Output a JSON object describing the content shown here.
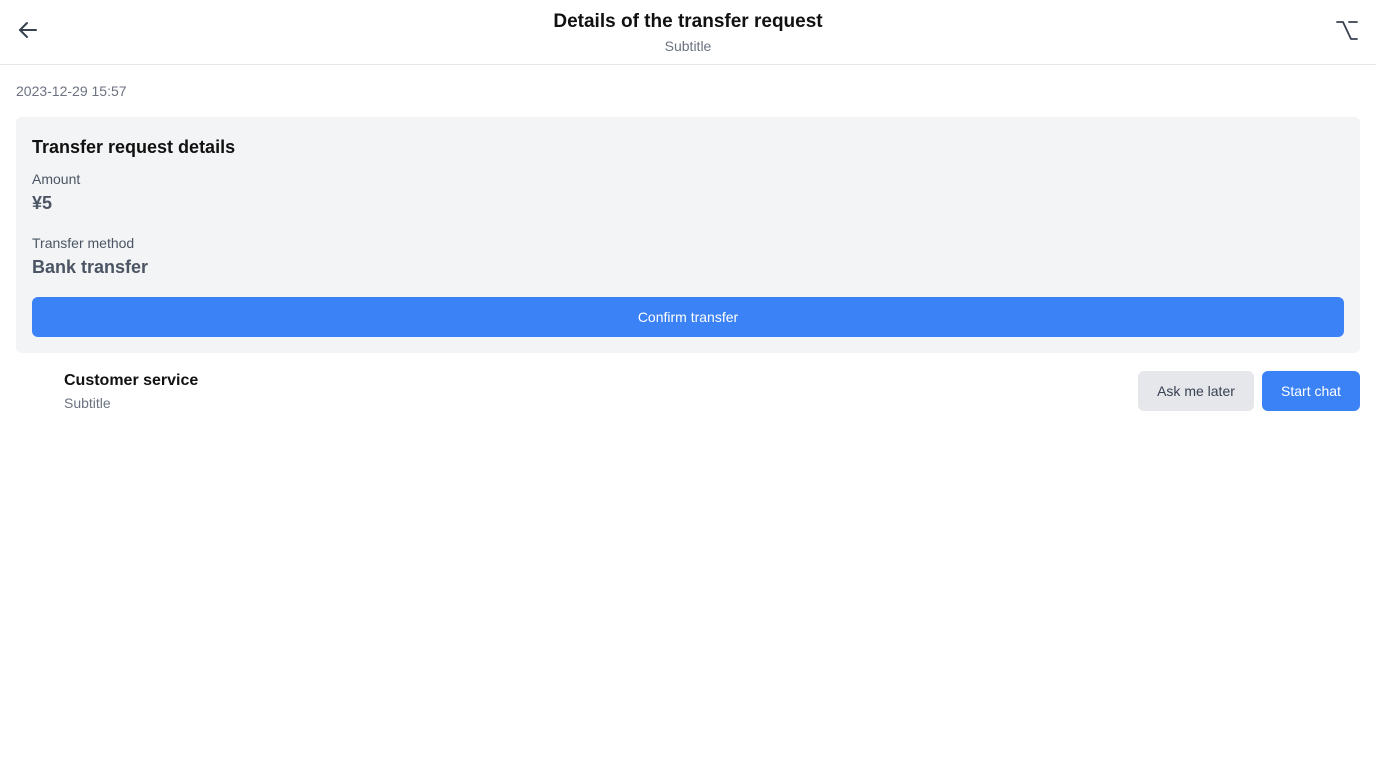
{
  "header": {
    "title": "Details of the transfer request",
    "subtitle": "Subtitle",
    "back_icon": "arrow-left-icon",
    "option_icon": "option-key-icon"
  },
  "timestamp": "2023-12-29 15:57",
  "card": {
    "title": "Transfer request details",
    "amount_label": "Amount",
    "amount_value": "¥5",
    "method_label": "Transfer method",
    "method_value": "Bank transfer",
    "confirm_label": "Confirm transfer"
  },
  "customer_service": {
    "title": "Customer service",
    "subtitle": "Subtitle",
    "ask_later_label": "Ask me later",
    "start_chat_label": "Start chat"
  },
  "colors": {
    "primary": "#3b82f6",
    "card_bg": "#f3f4f6",
    "secondary_btn_bg": "#e5e7eb",
    "muted_text": "#6b7280"
  }
}
